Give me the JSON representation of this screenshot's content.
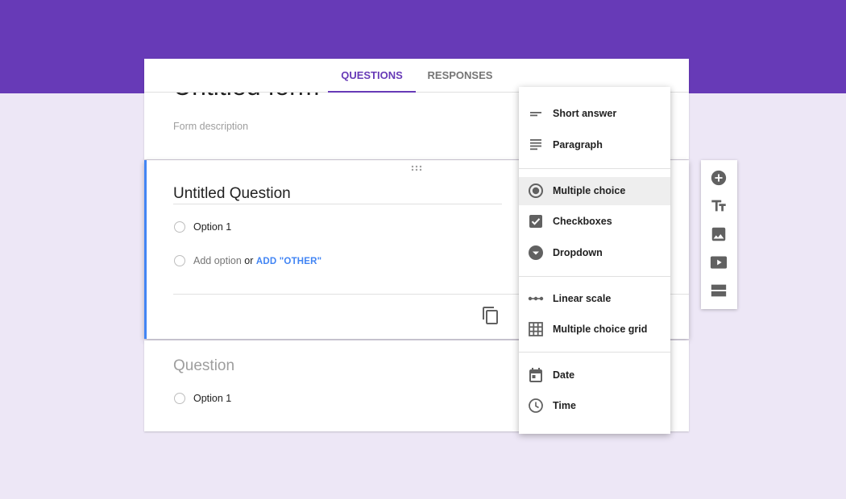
{
  "form": {
    "title": "Untitled form",
    "description_placeholder": "Form description"
  },
  "tabs": {
    "questions": "QUESTIONS",
    "responses": "RESPONSES"
  },
  "active_question": {
    "title": "Untitled Question",
    "option_1": "Option 1",
    "add_option": "Add option",
    "or_text": "or",
    "add_other": "ADD \"OTHER\""
  },
  "second_question": {
    "title_placeholder": "Question",
    "option_1": "Option 1"
  },
  "question_type_menu": {
    "selected": "Multiple choice",
    "items": [
      {
        "label": "Short answer",
        "icon": "short-text-icon"
      },
      {
        "label": "Paragraph",
        "icon": "paragraph-icon"
      },
      {
        "label": "Multiple choice",
        "icon": "radio-button-icon"
      },
      {
        "label": "Checkboxes",
        "icon": "checkbox-icon"
      },
      {
        "label": "Dropdown",
        "icon": "dropdown-circle-icon"
      },
      {
        "label": "Linear scale",
        "icon": "linear-scale-icon"
      },
      {
        "label": "Multiple choice grid",
        "icon": "grid-icon"
      },
      {
        "label": "Date",
        "icon": "calendar-icon"
      },
      {
        "label": "Time",
        "icon": "clock-icon"
      }
    ]
  },
  "side_toolbar": [
    {
      "icon": "add-circle-icon"
    },
    {
      "icon": "title-text-icon"
    },
    {
      "icon": "image-icon"
    },
    {
      "icon": "video-icon"
    },
    {
      "icon": "section-icon"
    }
  ],
  "colors": {
    "brand": "#673ab7",
    "page_background": "#ede7f6",
    "active_accent": "#4285f4",
    "link": "#4285f4",
    "icon": "#616161"
  }
}
